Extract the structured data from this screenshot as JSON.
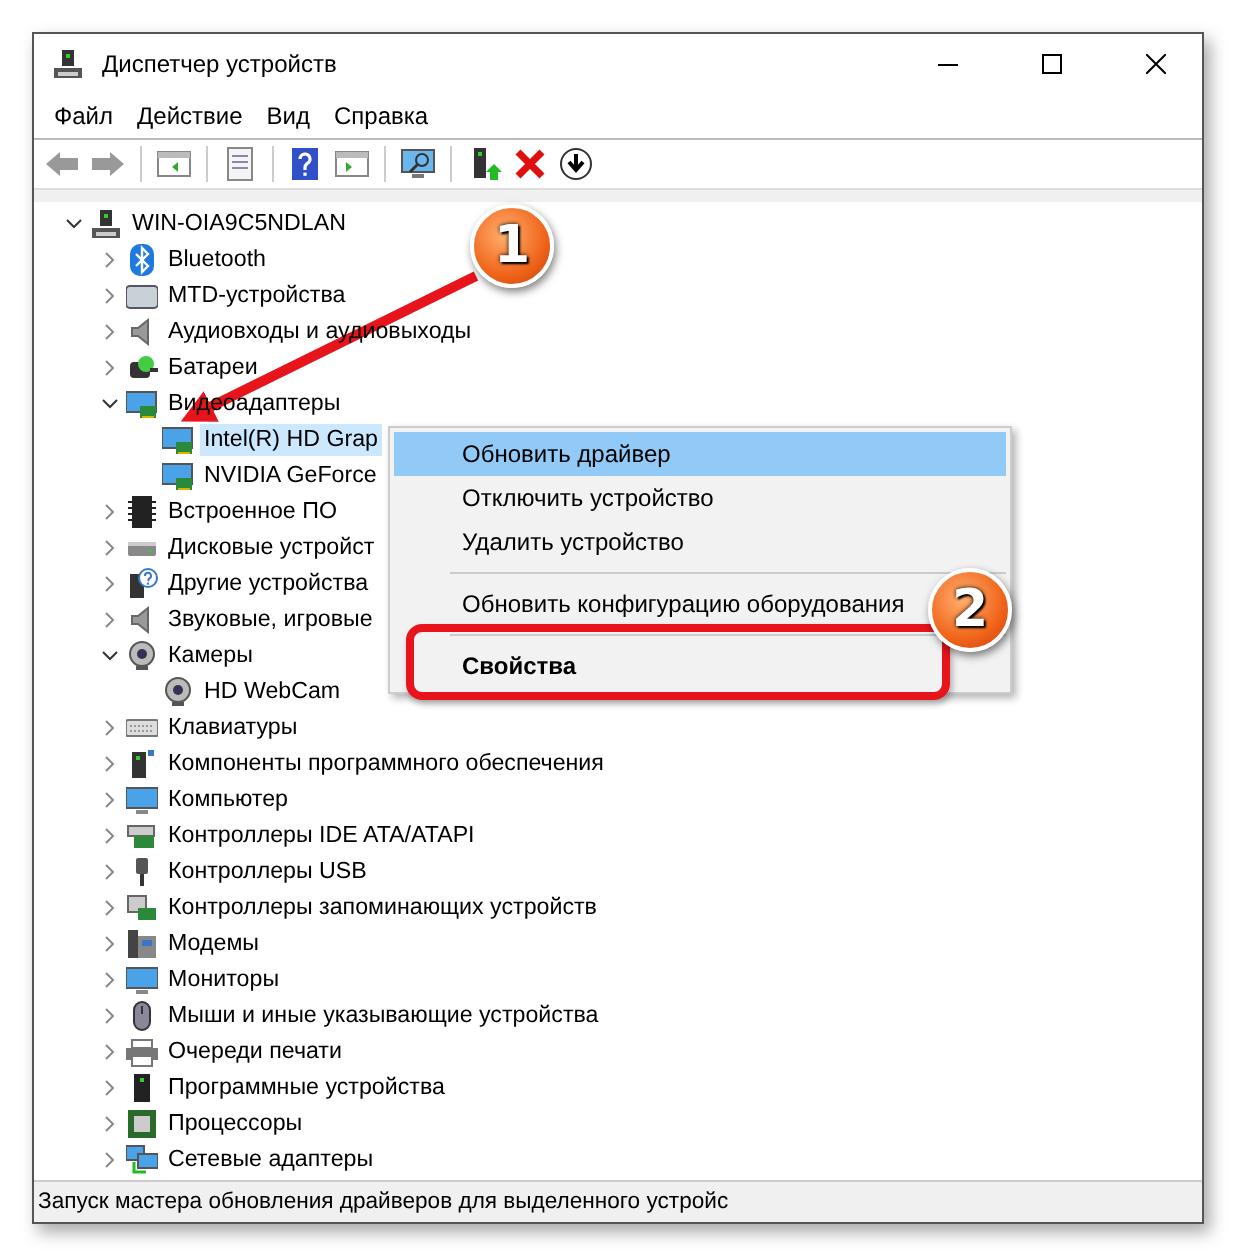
{
  "window": {
    "title": "Диспетчер устройств"
  },
  "menu": [
    "Файл",
    "Действие",
    "Вид",
    "Справка"
  ],
  "tree": {
    "label": "WIN-OIA9C5NDLAN",
    "expanded": true,
    "selected": false,
    "children": [
      {
        "label": "Bluetooth",
        "expanded": false,
        "selected": false
      },
      {
        "label": "MTD-устройства",
        "expanded": false,
        "selected": false
      },
      {
        "label": "Аудиовходы и аудиовыходы",
        "expanded": false,
        "selected": false
      },
      {
        "label": "Батареи",
        "expanded": false,
        "selected": false
      },
      {
        "label": "Видеоадаптеры",
        "expanded": true,
        "selected": false,
        "children": [
          {
            "label": "Intel(R) HD Grap",
            "selected": true
          },
          {
            "label": "NVIDIA GeForce",
            "selected": false
          }
        ]
      },
      {
        "label": "Встроенное ПО",
        "expanded": false,
        "selected": false
      },
      {
        "label": "Дисковые устройст",
        "expanded": false,
        "selected": false
      },
      {
        "label": "Другие устройства",
        "expanded": false,
        "selected": false
      },
      {
        "label": "Звуковые, игровые",
        "expanded": false,
        "selected": false
      },
      {
        "label": "Камеры",
        "expanded": true,
        "selected": false,
        "children": [
          {
            "label": "HD WebCam",
            "selected": false
          }
        ]
      },
      {
        "label": "Клавиатуры",
        "expanded": false,
        "selected": false
      },
      {
        "label": "Компоненты программного обеспечения",
        "expanded": false,
        "selected": false
      },
      {
        "label": "Компьютер",
        "expanded": false,
        "selected": false
      },
      {
        "label": "Контроллеры IDE ATA/ATAPI",
        "expanded": false,
        "selected": false
      },
      {
        "label": "Контроллеры USB",
        "expanded": false,
        "selected": false
      },
      {
        "label": "Контроллеры запоминающих устройств",
        "expanded": false,
        "selected": false
      },
      {
        "label": "Модемы",
        "expanded": false,
        "selected": false
      },
      {
        "label": "Мониторы",
        "expanded": false,
        "selected": false
      },
      {
        "label": "Мыши и иные указывающие устройства",
        "expanded": false,
        "selected": false
      },
      {
        "label": "Очереди печати",
        "expanded": false,
        "selected": false
      },
      {
        "label": "Программные устройства",
        "expanded": false,
        "selected": false
      },
      {
        "label": "Процессоры",
        "expanded": false,
        "selected": false
      },
      {
        "label": "Сетевые адаптеры",
        "expanded": false,
        "selected": false
      }
    ]
  },
  "context_menu": {
    "items": [
      {
        "kind": "item",
        "label": "Обновить драйвер",
        "selected": true,
        "default": false
      },
      {
        "kind": "item",
        "label": "Отключить устройство",
        "selected": false,
        "default": false
      },
      {
        "kind": "item",
        "label": "Удалить устройство",
        "selected": false,
        "default": false
      },
      {
        "kind": "separator"
      },
      {
        "kind": "item",
        "label": "Обновить конфигурацию оборудования",
        "selected": false,
        "default": false
      },
      {
        "kind": "separator"
      },
      {
        "kind": "item",
        "label": "Свойства",
        "selected": false,
        "default": true
      }
    ]
  },
  "status_bar": "Запуск мастера обновления драйверов для выделенного устройс",
  "callouts": [
    "1",
    "2"
  ]
}
